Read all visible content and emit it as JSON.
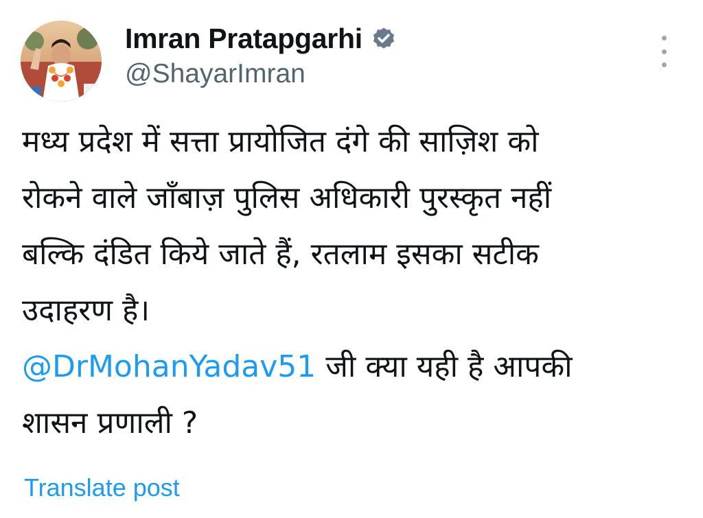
{
  "author": {
    "display_name": "Imran Pratapgarhi",
    "handle": "@ShayarImran",
    "verified_icon": "verified-badge-icon",
    "verified_color": "#6a7a8a"
  },
  "menu": {
    "icon": "more-vertical-icon"
  },
  "post": {
    "line1": "मध्य प्रदेश में सत्ता प्रायोजित दंगे की साज़िश को",
    "line2": "रोकने वाले जाँबाज़ पुलिस अधिकारी पुरस्कृत नहीं",
    "line3": "बल्कि दंडित किये जाते हैं, रतलाम इसका सटीक",
    "line4": "उदाहरण है।",
    "mention": "@DrMohanYadav51",
    "line5_rest": " जी क्या यही है आपकी",
    "line6": "शासन प्रणाली ?"
  },
  "translate": {
    "label": "Translate post"
  },
  "colors": {
    "link": "#1d9bf0",
    "text": "#0f1419",
    "secondary": "#536471"
  }
}
